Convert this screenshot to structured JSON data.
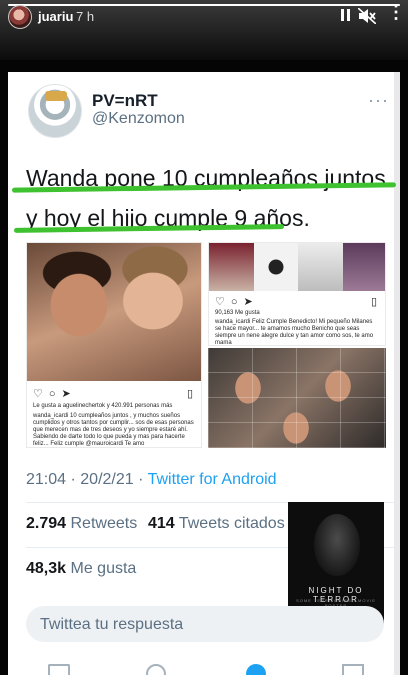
{
  "story": {
    "username": "juariu",
    "time": "7 h",
    "progress_fraction": 1.0,
    "icons": [
      "pause-icon",
      "mute-icon",
      "more-icon"
    ]
  },
  "tweet": {
    "display_name": "PV=nRT",
    "handle": "@Kenzomon",
    "more": "···",
    "text": "Wanda pone 10 cumpleaños juntos y hoy el hijo cumple 9 años.",
    "highlight_color": "#3ec22f",
    "meta": {
      "time": "21:04",
      "separator": " · ",
      "date": "20/2/21",
      "source": "Twitter for Android"
    },
    "stats": {
      "retweets_value": "2.794",
      "retweets_label": "Retweets",
      "quotes_value": "414",
      "quotes_label": "Tweets citados",
      "likes_value": "48,3k",
      "likes_label": "Me gusta"
    },
    "reply_placeholder": "Twittea tu respuesta",
    "accent_color": "#1da1f2"
  },
  "embedded_posts": {
    "left": {
      "liked_by": "Le gusta a aguelinechertok y 420.991 personas más",
      "caption": "wanda_icardi 10 cumpleaños juntos , y muchos sueños cumplidos y otros tantos por cumplir... sos de esas personas que merecen mas de tres deseos y yo siempre estaré ahí. Sabiendo de darte todo lo que pueda y mas para hacerte feliz... Feliz cumple @mauroicardi Te amo"
    },
    "right": {
      "likes": "90,163 Me gusta",
      "caption": "wanda_icardi Feliz Cumple Benedicto! Mi pequeño Milanes se hace mayor... te amamos mucho Benicho que seas siempre un nene alegre dulce y tan amor como sos, te amo mama"
    }
  },
  "ad": {
    "title": "NIGHT DO TERROR",
    "subtitle": "SOME TERRITORIES / MOVIE POSTER"
  },
  "bottom_nav": [
    "home-icon",
    "search-icon",
    "spaces-icon",
    "mail-icon"
  ]
}
